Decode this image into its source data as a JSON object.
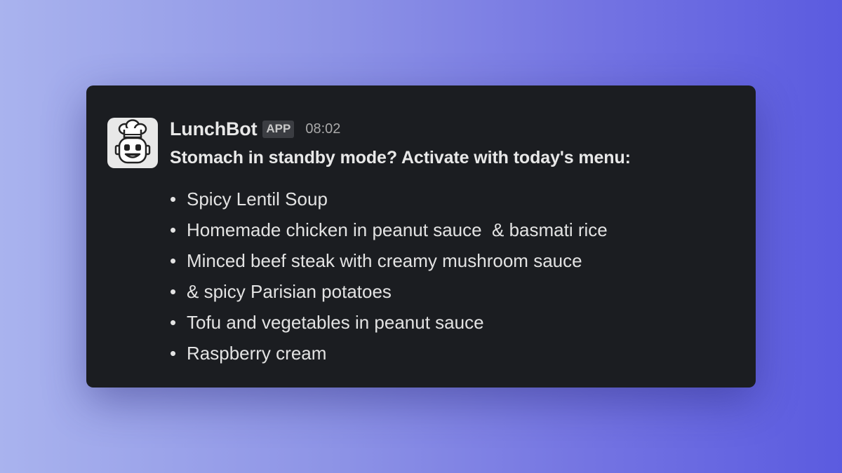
{
  "message": {
    "sender": "LunchBot",
    "badge": "APP",
    "time": "08:02",
    "headline": "Stomach in standby mode? Activate with today's menu:",
    "avatar_icon": "chef-robot-icon",
    "bullet": "•",
    "menu_items": [
      "Spicy Lentil Soup",
      "Homemade chicken in peanut sauce  & basmati rice",
      "Minced beef steak with creamy mushroom sauce",
      "& spicy Parisian potatoes",
      "Tofu and vegetables in peanut sauce",
      "Raspberry cream"
    ]
  },
  "colors": {
    "card_bg": "#1b1d21",
    "text": "#e8e8e8",
    "badge_bg": "#3b3d42",
    "timestamp": "#a9a9a9",
    "avatar_bg": "#e8e8e8"
  }
}
